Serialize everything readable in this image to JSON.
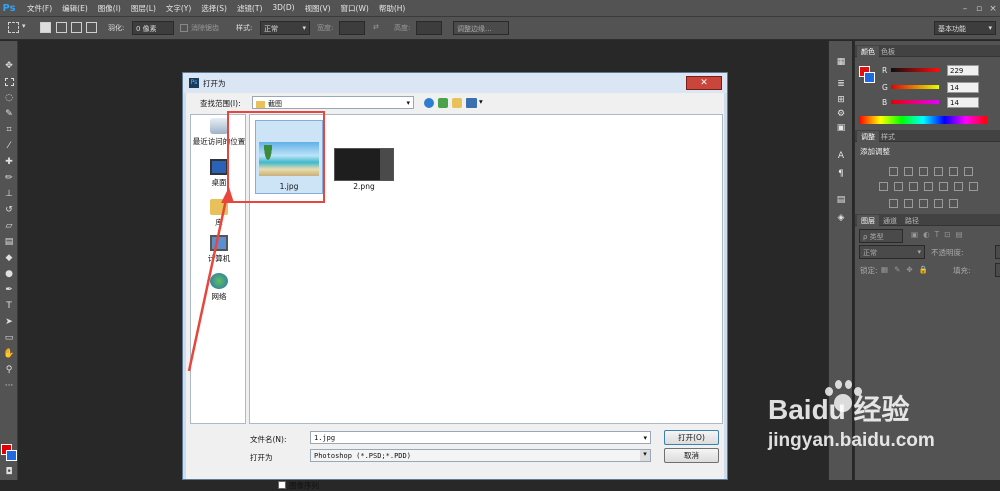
{
  "app": {
    "logo": "Ps"
  },
  "menu": [
    "文件(F)",
    "编辑(E)",
    "图像(I)",
    "图层(L)",
    "文字(Y)",
    "选择(S)",
    "滤镜(T)",
    "3D(D)",
    "视图(V)",
    "窗口(W)",
    "帮助(H)"
  ],
  "options": {
    "feather_label": "羽化:",
    "feather_value": "0 像素",
    "antialias_label": "消除锯齿",
    "style_label": "样式:",
    "style_value": "正常",
    "width_label": "宽度:",
    "height_label": "高度:",
    "refine_edge": "调整边缘...",
    "workspace": "基本功能"
  },
  "color_panel": {
    "tabs": [
      "颜色",
      "色板"
    ],
    "channels": [
      {
        "label": "R",
        "value": "229"
      },
      {
        "label": "G",
        "value": "14"
      },
      {
        "label": "B",
        "value": "14"
      }
    ],
    "fg_color": "#e50e0e",
    "bg_color": "#1f6ae0"
  },
  "adjust_panel": {
    "tabs": [
      "调整",
      "样式"
    ],
    "title": "添加调整"
  },
  "layers_panel": {
    "tabs": [
      "图层",
      "通道",
      "路径"
    ],
    "kind": "ρ 类型",
    "blend": "正常",
    "opacity_label": "不透明度:",
    "lock_label": "锁定:",
    "fill_label": "填充:"
  },
  "dialog": {
    "title": "打开为",
    "lookin_label": "查找范围(I):",
    "lookin_value": "截图",
    "places": [
      "最近访问的位置",
      "桌面",
      "库",
      "计算机",
      "网络"
    ],
    "files": [
      {
        "name": "1.jpg",
        "selected": true
      },
      {
        "name": "2.png",
        "selected": false
      }
    ],
    "filename_label": "文件名(N):",
    "filename_value": "1.jpg",
    "openas_label": "打开为",
    "openas_value": "Photoshop (*.PSD;*.PDD)",
    "open_button": "打开(O)",
    "cancel_button": "取消",
    "sequence_label": "图像序列"
  },
  "watermark": {
    "brand": "Baidu 经验",
    "url": "jingyan.baidu.com"
  },
  "accent": {
    "annotation": "#e8463c",
    "selection": "#cde4f7"
  }
}
